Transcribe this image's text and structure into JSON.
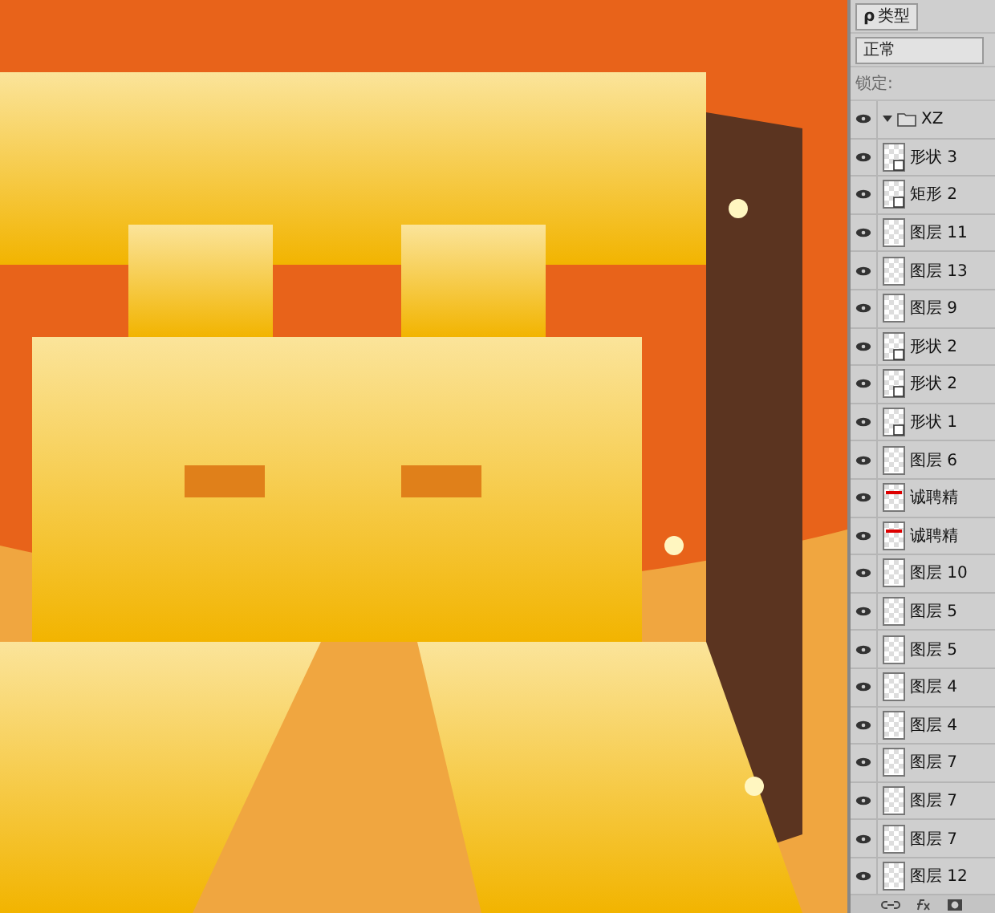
{
  "layers_panel": {
    "filter": {
      "icon": "ρ",
      "label": "类型"
    },
    "blend_mode": "正常",
    "lock_label": "锁定:",
    "group": {
      "name": "XZ",
      "expanded": true,
      "visible": true
    },
    "layers": [
      {
        "name": "形状 3",
        "kind": "shape",
        "visible": true
      },
      {
        "name": "矩形 2",
        "kind": "shape",
        "visible": true
      },
      {
        "name": "图层 11",
        "kind": "pixel",
        "visible": true
      },
      {
        "name": "图层 13",
        "kind": "pixel",
        "visible": true
      },
      {
        "name": "图层 9",
        "kind": "pixel",
        "visible": true
      },
      {
        "name": "形状 2",
        "kind": "shape",
        "visible": true
      },
      {
        "name": "形状 2",
        "kind": "shape",
        "visible": true
      },
      {
        "name": "形状 1",
        "kind": "shape",
        "visible": true
      },
      {
        "name": "图层 6",
        "kind": "pixel",
        "visible": true
      },
      {
        "name": "诚聘精",
        "kind": "text",
        "visible": true
      },
      {
        "name": "诚聘精",
        "kind": "text",
        "visible": true
      },
      {
        "name": "图层 10",
        "kind": "pixel",
        "visible": true
      },
      {
        "name": "图层 5",
        "kind": "pixel",
        "visible": true
      },
      {
        "name": "图层 5",
        "kind": "pixel",
        "visible": true
      },
      {
        "name": "图层 4",
        "kind": "pixel",
        "visible": true
      },
      {
        "name": "图层 4",
        "kind": "pixel",
        "visible": true
      },
      {
        "name": "图层 7",
        "kind": "pixel",
        "visible": true
      },
      {
        "name": "图层 7",
        "kind": "pixel",
        "visible": true
      },
      {
        "name": "图层 7",
        "kind": "pixel",
        "visible": true
      },
      {
        "name": "图层 12",
        "kind": "pixel",
        "visible": true
      }
    ]
  }
}
